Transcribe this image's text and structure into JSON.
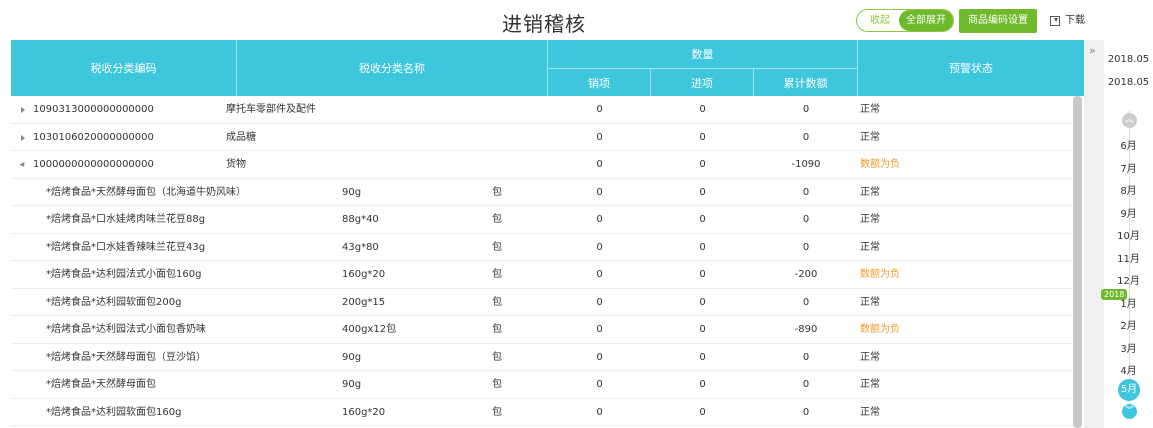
{
  "header": {
    "title": "进销稽核",
    "toggle_off_label": "收起",
    "toggle_on_label": "全部展开",
    "code_settings_label": "商品编码设置",
    "download_label": "下载"
  },
  "table": {
    "col_code": "税收分类编码",
    "col_name": "税收分类名称",
    "col_qty": "数量",
    "col_sales": "销项",
    "col_purchase": "进项",
    "col_cumulative": "累计数额",
    "col_status": "预警状态",
    "category_rows": [
      {
        "code": "1090313000000000000",
        "name": "摩托车零部件及配件",
        "sales": "0",
        "purchase": "0",
        "cumulative": "0",
        "status": "正常",
        "expanded": false
      },
      {
        "code": "1030106020000000000",
        "name": "成品糖",
        "sales": "0",
        "purchase": "0",
        "cumulative": "0",
        "status": "正常",
        "expanded": false
      },
      {
        "code": "1000000000000000000",
        "name": "货物",
        "sales": "0",
        "purchase": "0",
        "cumulative": "-1090",
        "status": "数额为负",
        "expanded": true
      }
    ],
    "item_rows": [
      {
        "name": "*焙烤食品*天然酵母面包（北海道牛奶风味）",
        "spec": "90g",
        "unit": "包",
        "sales": "0",
        "purchase": "0",
        "cumulative": "0",
        "status": "正常"
      },
      {
        "name": "*焙烤食品*口水娃烤肉味兰花豆88g",
        "spec": "88g*40",
        "unit": "包",
        "sales": "0",
        "purchase": "0",
        "cumulative": "0",
        "status": "正常"
      },
      {
        "name": "*焙烤食品*口水娃香辣味兰花豆43g",
        "spec": "43g*80",
        "unit": "包",
        "sales": "0",
        "purchase": "0",
        "cumulative": "0",
        "status": "正常"
      },
      {
        "name": "*焙烤食品*达利园法式小面包160g",
        "spec": "160g*20",
        "unit": "包",
        "sales": "0",
        "purchase": "0",
        "cumulative": "-200",
        "status": "数额为负"
      },
      {
        "name": "*焙烤食品*达利园软面包200g",
        "spec": "200g*15",
        "unit": "包",
        "sales": "0",
        "purchase": "0",
        "cumulative": "0",
        "status": "正常"
      },
      {
        "name": "*焙烤食品*达利园法式小面包香奶味",
        "spec": "400gx12包",
        "unit": "包",
        "sales": "0",
        "purchase": "0",
        "cumulative": "-890",
        "status": "数额为负"
      },
      {
        "name": "*焙烤食品*天然酵母面包（豆沙馅）",
        "spec": "90g",
        "unit": "包",
        "sales": "0",
        "purchase": "0",
        "cumulative": "0",
        "status": "正常"
      },
      {
        "name": "*焙烤食品*天然酵母面包",
        "spec": "90g",
        "unit": "包",
        "sales": "0",
        "purchase": "0",
        "cumulative": "0",
        "status": "正常"
      },
      {
        "name": "*焙烤食品*达利园软面包160g",
        "spec": "160g*20",
        "unit": "包",
        "sales": "0",
        "purchase": "0",
        "cumulative": "0",
        "status": "正常"
      }
    ]
  },
  "sidebar": {
    "collapse_icon": "double-chevron-right-icon",
    "date_start": "2018.05",
    "date_end": "2018.05",
    "year_tag": "2018",
    "months": [
      "6月",
      "7月",
      "8月",
      "9月",
      "10月",
      "11月",
      "12月",
      "1月",
      "2月",
      "3月",
      "4月",
      "5月"
    ],
    "active_month": "5月"
  },
  "colors": {
    "header_bg": "#3dc6dc",
    "accent_green": "#6fba2c",
    "warning": "#f29b2a"
  }
}
